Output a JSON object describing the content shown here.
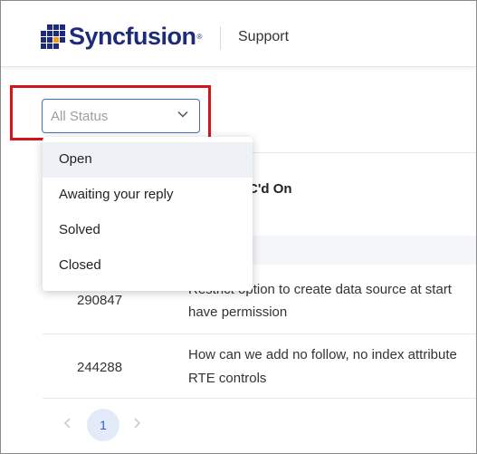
{
  "header": {
    "brand": "Syncfusion",
    "brand_mark": "®",
    "section": "Support",
    "logo_colors": [
      "#1e2b7a",
      "#f39c12"
    ]
  },
  "filter": {
    "status_placeholder": "All Status",
    "options": [
      "Open",
      "Awaiting your reply",
      "Solved",
      "Closed"
    ],
    "highlighted_option": "Open"
  },
  "table": {
    "partial_header": "C'd On",
    "rows": [
      {
        "id": "290847",
        "title_line1": "Restrict option to create data source at start",
        "title_line2": "have permission"
      },
      {
        "id": "244288",
        "title_line1": "How can we add no follow, no index attribute",
        "title_line2": "RTE controls"
      }
    ]
  },
  "pagination": {
    "current_page": "1"
  },
  "colors": {
    "highlight_border": "#d4151c",
    "select_border": "#3f6fc4",
    "page_active_bg": "#e3ebf9"
  }
}
